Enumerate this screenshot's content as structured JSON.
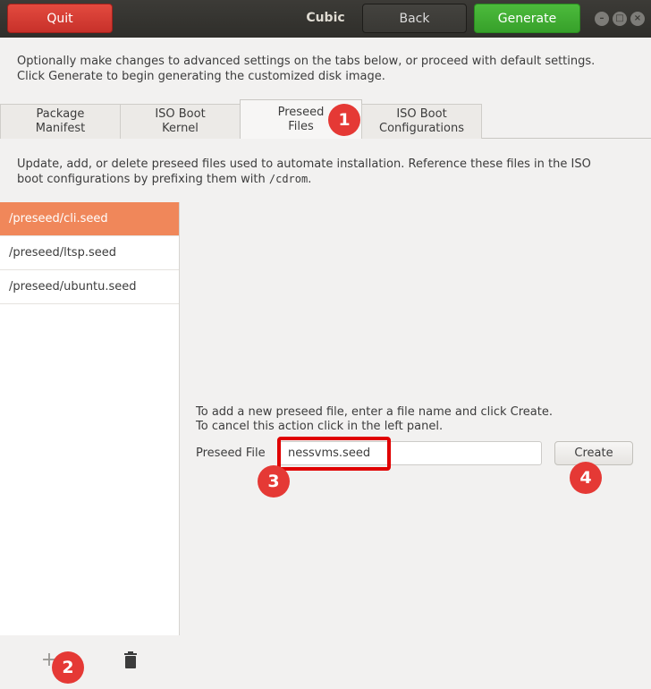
{
  "window": {
    "title": "Cubic",
    "quit_label": "Quit",
    "back_label": "Back",
    "generate_label": "Generate"
  },
  "intro": {
    "line1": "Optionally make changes to advanced settings on the tabs below, or proceed with default settings.",
    "line2": "Click Generate to begin generating the customized disk image."
  },
  "tabs": [
    {
      "line1": "Package",
      "line2": "Manifest"
    },
    {
      "line1": "ISO Boot",
      "line2": "Kernel"
    },
    {
      "line1": "Preseed",
      "line2": "Files",
      "active": true
    },
    {
      "line1": "ISO Boot",
      "line2": "Configurations"
    }
  ],
  "description": {
    "line1": "Update, add, or delete preseed files used to automate installation. Reference these files in the ISO",
    "line2_prefix": "boot configurations by prefixing them with ",
    "line2_code": "/cdrom",
    "line2_suffix": "."
  },
  "preseed_files": [
    {
      "name": "/preseed/cli.seed",
      "selected": true
    },
    {
      "name": "/preseed/ltsp.seed"
    },
    {
      "name": "/preseed/ubuntu.seed"
    }
  ],
  "new_file": {
    "instruction1": "To add a new preseed file, enter a file name and click Create.",
    "instruction2": "To cancel this action click in the left panel.",
    "label": "Preseed File",
    "value": "nessvms.seed",
    "create_label": "Create"
  },
  "toolbar": {
    "add_icon": "plus-icon",
    "delete_icon": "trash-icon"
  },
  "annotations": [
    "1",
    "2",
    "3",
    "4"
  ],
  "colors": {
    "selected_row": "#f0875a",
    "generate": "#3fae31",
    "quit": "#d8392f",
    "badge": "#e53935",
    "highlight": "#e00000"
  }
}
